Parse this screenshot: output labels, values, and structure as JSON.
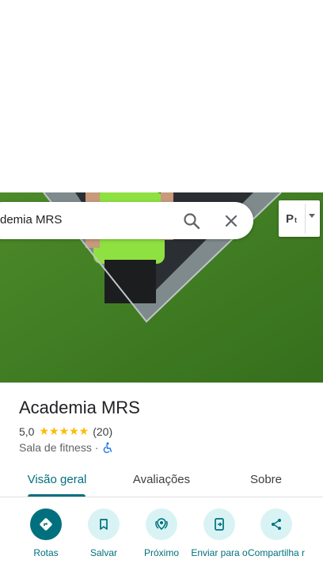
{
  "search": {
    "query": "Academia MRS",
    "visible_text": "demia MRS"
  },
  "layer_selector": {
    "label_main": "P",
    "label_sub": "t"
  },
  "place": {
    "name": "Academia MRS",
    "rating": "5,0",
    "stars": "★★★★★",
    "review_count": "(20)",
    "category": "Sala de fitness",
    "separator": "·"
  },
  "tabs": [
    {
      "label": "Visão geral",
      "active": true
    },
    {
      "label": "Avaliações",
      "active": false
    },
    {
      "label": "Sobre",
      "active": false
    }
  ],
  "actions": [
    {
      "label": "Rotas",
      "icon": "directions-icon"
    },
    {
      "label": "Salvar",
      "icon": "bookmark-icon"
    },
    {
      "label": "Próximo",
      "icon": "nearby-icon"
    },
    {
      "label": "Enviar para o",
      "icon": "send-to-phone-icon"
    },
    {
      "label": "Compartilha r",
      "icon": "share-icon"
    }
  ],
  "colors": {
    "accent": "#00707e",
    "action_bg": "#d9f3f5",
    "star": "#fbbc04",
    "accessible": "#1a73e8"
  }
}
